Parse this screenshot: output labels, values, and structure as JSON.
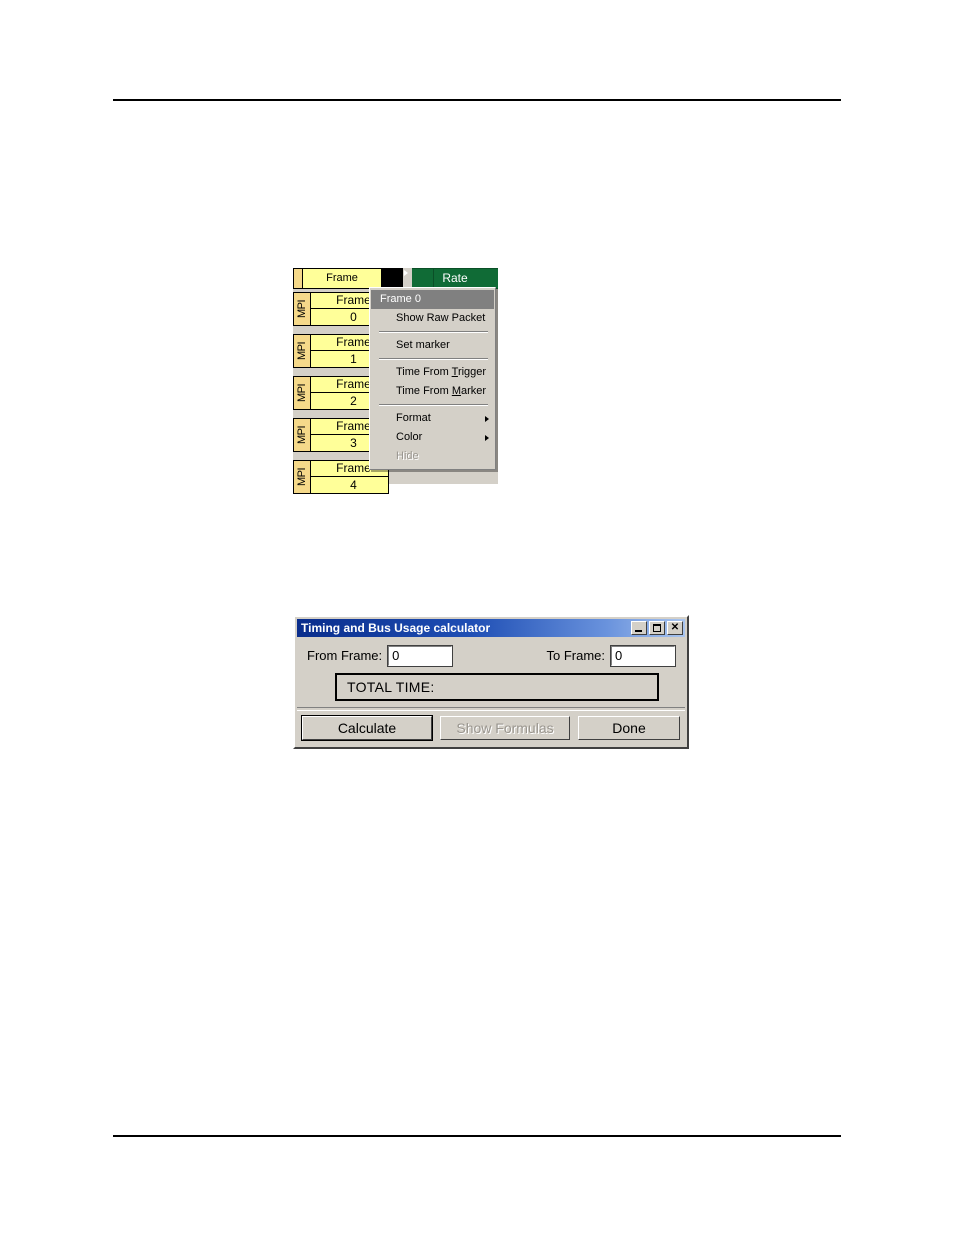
{
  "page": {
    "background": "#ffffff",
    "rule_color": "#000000"
  },
  "figure_frames": {
    "name": "Frame list with right-click context menu",
    "grid_header": {
      "mpi_label": "",
      "frame_label": "Frame",
      "rate_label": "Rate",
      "black_block": "",
      "marker_icon": "marker-triangle-icon",
      "rate_bg": "#106b36",
      "frame_bg": "#ffff99",
      "mpi_bg": "#f5d98a"
    },
    "rows": [
      {
        "bus": "MPI",
        "label": "Frame",
        "number": "0"
      },
      {
        "bus": "MPI",
        "label": "Frame",
        "number": "1"
      },
      {
        "bus": "MPI",
        "label": "Frame",
        "number": "2"
      },
      {
        "bus": "MPI",
        "label": "Frame",
        "number": "3"
      },
      {
        "bus": "MPI",
        "label": "Frame",
        "number": "4"
      }
    ],
    "context_menu": {
      "header": "Frame 0",
      "items": [
        {
          "label": "Show Raw Packet",
          "type": "item",
          "disabled": false,
          "submenu": false,
          "accel_index": -1
        },
        {
          "type": "separator"
        },
        {
          "label": "Set marker",
          "type": "item",
          "disabled": false,
          "submenu": false,
          "accel_index": -1
        },
        {
          "type": "separator"
        },
        {
          "label": "Time From Trigger",
          "type": "item",
          "disabled": false,
          "submenu": false,
          "accel_prefix": "Time From ",
          "accel_char": "T",
          "accel_suffix": "rigger"
        },
        {
          "label": "Time From Marker",
          "type": "item",
          "disabled": false,
          "submenu": false,
          "accel_prefix": "Time From ",
          "accel_char": "M",
          "accel_suffix": "arker"
        },
        {
          "type": "separator"
        },
        {
          "label": "Format",
          "type": "item",
          "disabled": false,
          "submenu": true
        },
        {
          "label": "Color",
          "type": "item",
          "disabled": false,
          "submenu": true
        },
        {
          "label": "Hide",
          "type": "item",
          "disabled": true,
          "submenu": false
        }
      ],
      "selected_bg": "#808080",
      "menu_bg": "#d4d0c8"
    }
  },
  "dialog_timing": {
    "title": "Timing and Bus Usage calculator",
    "titlebar_color": "#0a2d8c",
    "window_buttons": {
      "minimize": "minimize-icon",
      "maximize": "maximize-icon",
      "close": "close-icon"
    },
    "fields": {
      "from_frame_label": "From Frame:",
      "from_frame_value": "0",
      "to_frame_label": "To Frame:",
      "to_frame_value": "0"
    },
    "total_time_label": "TOTAL TIME:",
    "total_time_value": "",
    "buttons": {
      "calculate": "Calculate",
      "show_formulas": "Show Formulas",
      "show_formulas_disabled": true,
      "done": "Done"
    }
  }
}
